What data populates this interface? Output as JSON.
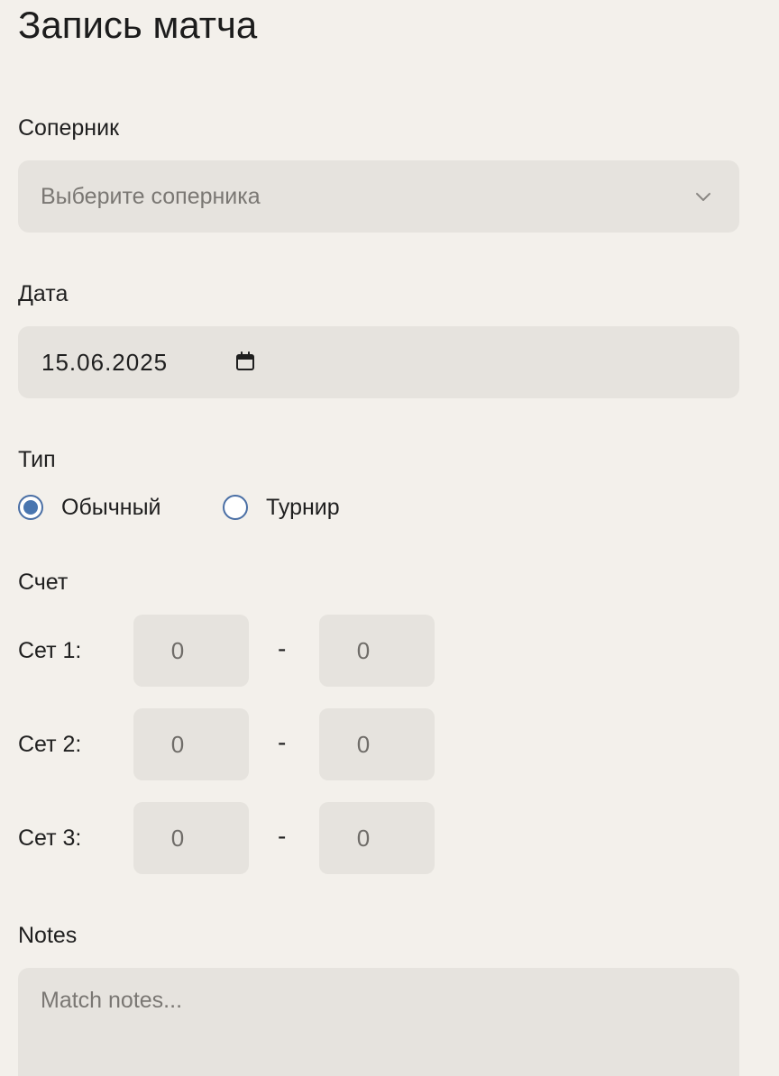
{
  "page": {
    "title": "Запись матча"
  },
  "opponent": {
    "label": "Соперник",
    "placeholder": "Выберите соперника"
  },
  "date": {
    "label": "Дата",
    "value": "15.06.2025"
  },
  "type": {
    "label": "Тип",
    "options": [
      {
        "label": "Обычный",
        "checked": true
      },
      {
        "label": "Турнир",
        "checked": false
      }
    ]
  },
  "score": {
    "label": "Счет",
    "sets": [
      {
        "label": "Сет 1:",
        "player": "0",
        "opponent": "0"
      },
      {
        "label": "Сет 2:",
        "player": "0",
        "opponent": "0"
      },
      {
        "label": "Сет 3:",
        "player": "0",
        "opponent": "0"
      }
    ],
    "separator": "-"
  },
  "notes": {
    "label": "Notes",
    "placeholder": "Match notes..."
  },
  "colors": {
    "background": "#f3f0eb",
    "field": "#e6e3de",
    "accent": "#4a76b0"
  },
  "icons": {
    "opponent_dropdown": "chevron-down-icon",
    "date_picker": "calendar-icon"
  }
}
